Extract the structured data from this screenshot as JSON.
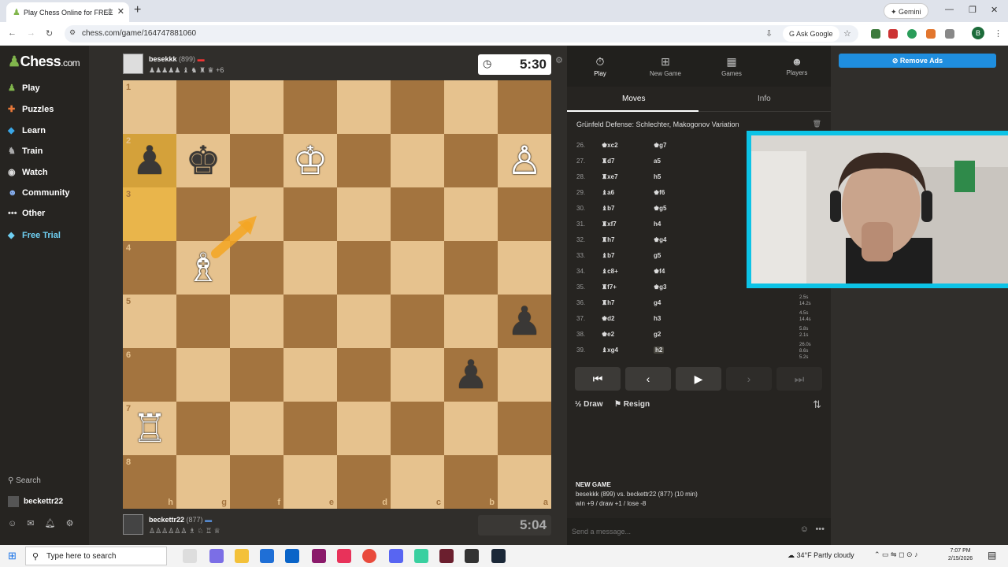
{
  "browser": {
    "tab_title": "Play Chess Online for FREE",
    "url": "chess.com/game/164747881060",
    "ask_google": "Ask Google",
    "gemini": "Gemini",
    "profile_initial": "B"
  },
  "sidebar": {
    "logo": "Chess",
    "logo_suffix": ".com",
    "items": [
      {
        "label": "Play",
        "icon": "pawn-icon"
      },
      {
        "label": "Puzzles",
        "icon": "puzzle-icon"
      },
      {
        "label": "Learn",
        "icon": "learn-icon"
      },
      {
        "label": "Train",
        "icon": "train-icon"
      },
      {
        "label": "Watch",
        "icon": "watch-icon"
      },
      {
        "label": "Community",
        "icon": "community-icon"
      },
      {
        "label": "Other",
        "icon": "more-icon"
      },
      {
        "label": "Free Trial",
        "icon": "diamond-icon"
      }
    ],
    "search": "Search",
    "username": "beckettr22"
  },
  "opponent": {
    "name": "besekkk",
    "rating": "(899)",
    "captured": "♟♟♟♟♟ ♝ ♞ ♜ ♛",
    "advantage": "+6",
    "clock": "5:30"
  },
  "player": {
    "name": "beckettr22",
    "rating": "(877)",
    "captured": "♙♙♙♙♙♙ ♗ ♘ ♖ ♕",
    "clock": "5:04"
  },
  "board": {
    "ranks": [
      "1",
      "2",
      "3",
      "4",
      "5",
      "6",
      "7",
      "8"
    ],
    "files": [
      "h",
      "g",
      "f",
      "e",
      "d",
      "c",
      "b",
      "a"
    ],
    "highlight_squares": [
      "h2",
      "h3"
    ],
    "pieces": [
      {
        "sq": "h2",
        "p": "♟",
        "c": "black"
      },
      {
        "sq": "g2",
        "p": "♚",
        "c": "black"
      },
      {
        "sq": "e2",
        "p": "♔",
        "c": "white"
      },
      {
        "sq": "a2",
        "p": "♙",
        "c": "white"
      },
      {
        "sq": "g4",
        "p": "♗",
        "c": "white"
      },
      {
        "sq": "a5",
        "p": "♟",
        "c": "black"
      },
      {
        "sq": "b6",
        "p": "♟",
        "c": "black"
      },
      {
        "sq": "h7",
        "p": "♖",
        "c": "white"
      }
    ]
  },
  "panel": {
    "tabs": [
      {
        "label": "Play",
        "icon": "stopwatch-icon"
      },
      {
        "label": "New Game",
        "icon": "plus-icon"
      },
      {
        "label": "Games",
        "icon": "grid-icon"
      },
      {
        "label": "Players",
        "icon": "players-icon"
      }
    ],
    "subtabs": {
      "moves": "Moves",
      "info": "Info"
    },
    "opening": "Grünfeld Defense: Schlechter, Makogonov Variation",
    "moves": [
      {
        "n": "26.",
        "w": "♚xc2",
        "b": "♚g7"
      },
      {
        "n": "27.",
        "w": "♜d7",
        "b": "a5"
      },
      {
        "n": "28.",
        "w": "♜xe7",
        "b": "h5"
      },
      {
        "n": "29.",
        "w": "♝a6",
        "b": "♚f6"
      },
      {
        "n": "30.",
        "w": "♝b7",
        "b": "♚g5"
      },
      {
        "n": "31.",
        "w": "♜xf7",
        "b": "h4"
      },
      {
        "n": "32.",
        "w": "♜h7",
        "b": "♚g4"
      },
      {
        "n": "33.",
        "w": "♝b7",
        "b": "g5"
      },
      {
        "n": "34.",
        "w": "♝c8+",
        "b": "♚f4"
      },
      {
        "n": "35.",
        "w": "♜f7+",
        "b": "♚g3"
      },
      {
        "n": "36.",
        "w": "♜h7",
        "b": "g4",
        "t1": "2.5s",
        "t2": "14.2s"
      },
      {
        "n": "37.",
        "w": "♚d2",
        "b": "h3",
        "t1": "4.5s",
        "t2": "14.4s"
      },
      {
        "n": "38.",
        "w": "♚e2",
        "b": "g2",
        "t1": "5.8s",
        "t2": "2.1s"
      },
      {
        "n": "39.",
        "w": "♝xg4",
        "b": "h2",
        "t1": "26.0s",
        "t2": "8.6s",
        "t3": "5.2s"
      }
    ],
    "draw": "Draw",
    "resign": "Resign",
    "new_game_title": "NEW GAME",
    "new_game_line1": "besekkk (899) vs. beckettr22 (877) (10 min)",
    "new_game_line2": "win +9 / draw +1 / lose -8",
    "chat_placeholder": "Send a message..."
  },
  "right": {
    "remove_ads": "Remove Ads"
  },
  "taskbar": {
    "search": "Type here to search",
    "weather": "34°F  Partly cloudy",
    "time": "7:07 PM",
    "date": "2/15/2026"
  }
}
